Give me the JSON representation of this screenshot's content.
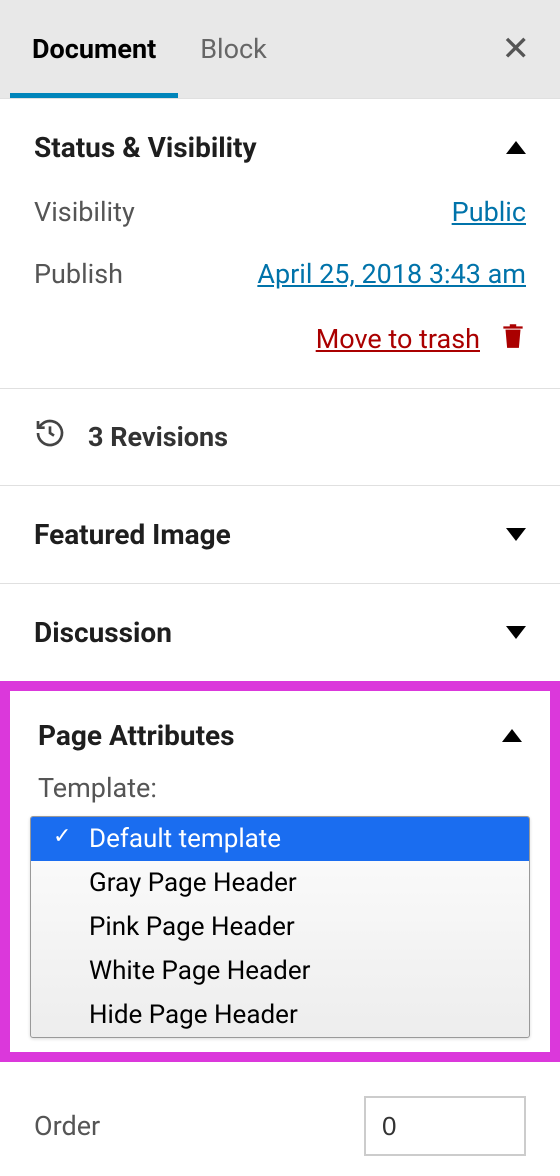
{
  "tabs": {
    "document": "Document",
    "block": "Block"
  },
  "status_visibility": {
    "title": "Status & Visibility",
    "visibility_label": "Visibility",
    "visibility_value": "Public",
    "publish_label": "Publish",
    "publish_value": "April 25, 2018 3:43 am",
    "trash_label": "Move to trash"
  },
  "revisions": {
    "text": "3 Revisions"
  },
  "featured_image": {
    "title": "Featured Image"
  },
  "discussion": {
    "title": "Discussion"
  },
  "page_attributes": {
    "title": "Page Attributes",
    "template_label": "Template:",
    "options": [
      "Default template",
      "Gray Page Header",
      "Pink Page Header",
      "White Page Header",
      "Hide Page Header"
    ]
  },
  "order": {
    "label": "Order",
    "value": "0"
  }
}
